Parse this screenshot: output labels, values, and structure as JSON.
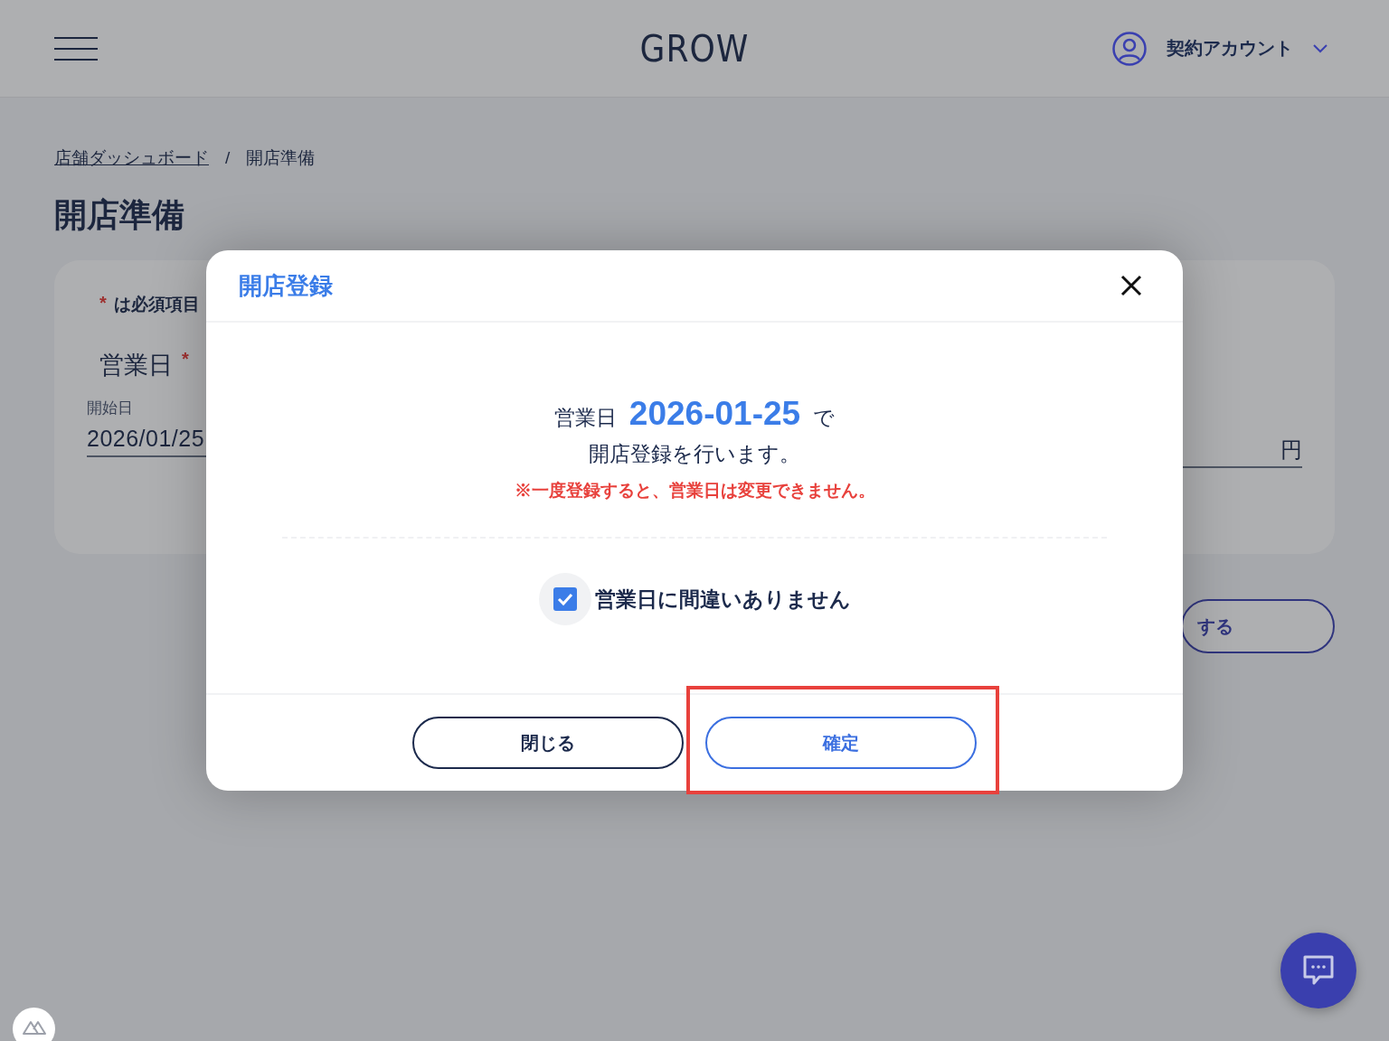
{
  "header": {
    "logo": "GROW",
    "account": "契約アカウント"
  },
  "breadcrumb": [
    {
      "label": "店舗ダッシュボード",
      "link": true
    },
    {
      "label": "開店準備",
      "link": false
    }
  ],
  "breadcrumb_separator": "/",
  "page_title": "開店準備",
  "form": {
    "required_mark": "*",
    "required_note": "は必須項目",
    "field_label": "営業日",
    "field_required_mark": "*",
    "start_label": "開始日",
    "start_value": "2026/01/25",
    "unit": "円",
    "action_button": "する"
  },
  "dialog": {
    "title": "開店登録",
    "message_prefix": "営業日",
    "date": "2026-01-25",
    "message_suffix": "で",
    "message_line2": "開店登録を行います。",
    "warning": "※一度登録すると、営業日は変更できません。",
    "confirm_check": {
      "label": "営業日に間違いありません",
      "checked": true
    },
    "buttons": [
      {
        "label": "閉じる",
        "kind": "secondary",
        "highlighted": false
      },
      {
        "label": "確定",
        "kind": "primary",
        "highlighted": true
      }
    ]
  }
}
